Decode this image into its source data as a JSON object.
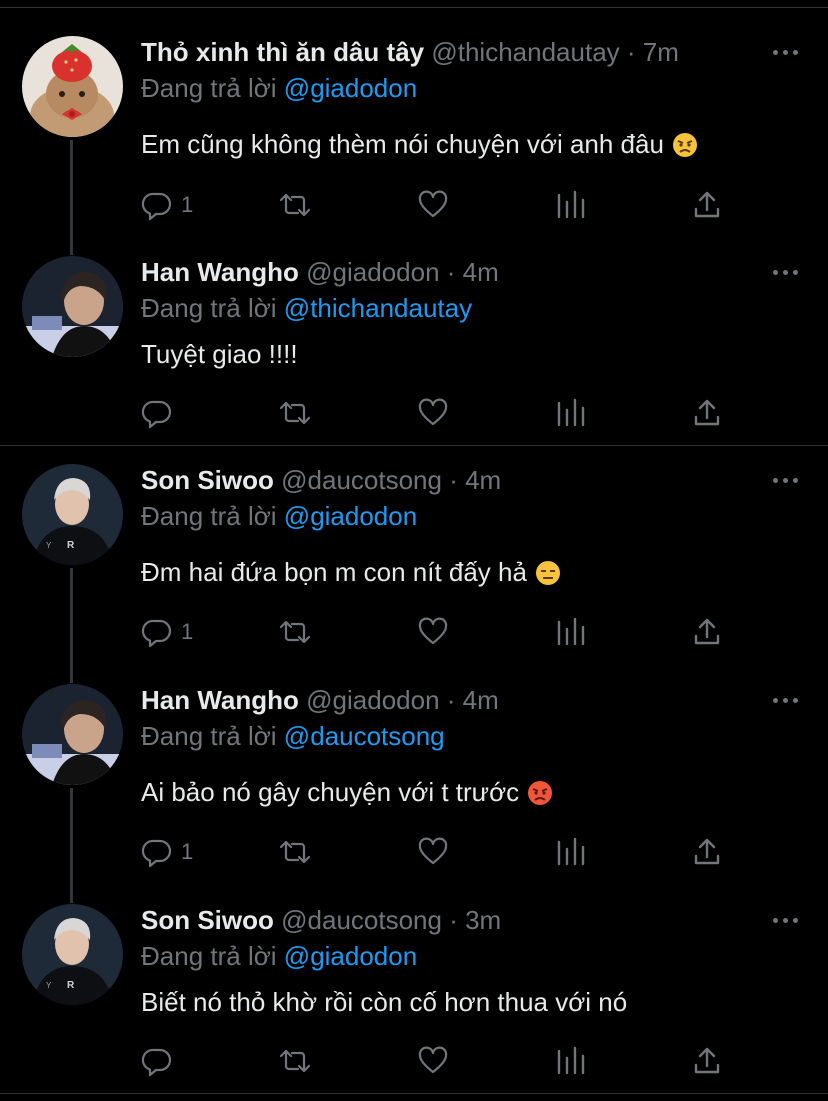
{
  "reply_prefix": "Đang trả lời",
  "tweets": [
    {
      "name": "Thỏ xinh thì ăn dâu tây",
      "handle": "@thichandautay",
      "time": "· 7m",
      "reply_to": "@giadodon",
      "text": "Em cũng không thèm nói chuyện với anh đâu",
      "emoji": "😠",
      "reply_count": "1",
      "avatar": "rabbit-strawberry-hat"
    },
    {
      "name": "Han Wangho",
      "handle": "@giadodon",
      "time": "· 4m",
      "reply_to": "@thichandautay",
      "text": "Tuyệt giao !!!!",
      "emoji": "",
      "reply_count": "",
      "avatar": "man-dark-room"
    },
    {
      "name": "Son Siwoo",
      "handle": "@daucotsong",
      "time": "· 4m",
      "reply_to": "@giadodon",
      "text": "Đm hai đứa bọn m con nít đấy hả",
      "emoji": "😑",
      "reply_count": "1",
      "avatar": "man-black-jersey"
    },
    {
      "name": "Han Wangho",
      "handle": "@giadodon",
      "time": "· 4m",
      "reply_to": "@daucotsong",
      "text": "Ai bảo nó gây chuyện với t trước",
      "emoji": "😡",
      "reply_count": "1",
      "avatar": "man-dark-room"
    },
    {
      "name": "Son Siwoo",
      "handle": "@daucotsong",
      "time": "· 3m",
      "reply_to": "@giadodon",
      "text": "Biết nó thỏ khờ rồi còn cố hơn thua với nó",
      "emoji": "",
      "reply_count": "",
      "avatar": "man-black-jersey"
    }
  ],
  "colors": {
    "background": "#000000",
    "text": "#e7e9ea",
    "muted": "#71767b",
    "link": "#1d9bf0",
    "divider": "#2f3336"
  }
}
